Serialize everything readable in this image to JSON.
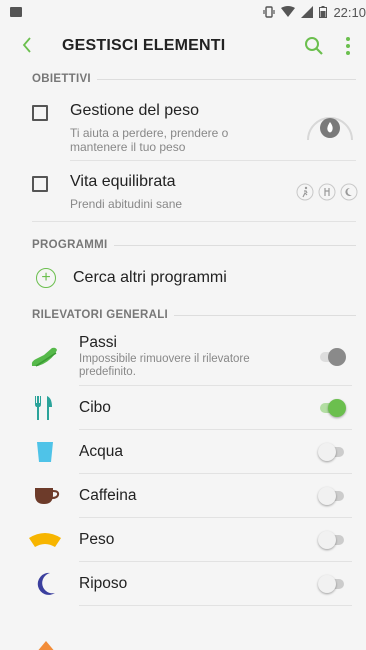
{
  "status_bar": {
    "time": "22:10"
  },
  "app_bar": {
    "back_icon": "chevron-left-icon",
    "title": "GESTISCI ELEMENTI",
    "actions": [
      "search-icon",
      "more-vertical-icon"
    ],
    "accent_color": "#6bbf4e"
  },
  "goals": {
    "header": "OBIETTIVI",
    "items": [
      {
        "title": "Gestione del peso",
        "description": "Ti aiuta a perdere, prendere o mantenere il tuo peso",
        "checked": false,
        "icon": "weight-gauge-icon"
      },
      {
        "title": "Vita equilibrata",
        "description": "Prendi abitudini sane",
        "checked": false,
        "icon": "activity-food-sleep-icons"
      }
    ]
  },
  "programs": {
    "header": "PROGRAMMI",
    "find_more_label": "Cerca altri programmi"
  },
  "trackers": {
    "header": "RILEVATORI GENERALI",
    "items": [
      {
        "label": "Passi",
        "sublabel": "Impossibile rimuovere il rilevatore predefinito.",
        "icon": "shoe-icon",
        "state": "locked-on"
      },
      {
        "label": "Cibo",
        "icon": "fork-knife-icon",
        "state": "on"
      },
      {
        "label": "Acqua",
        "icon": "water-glass-icon",
        "state": "off"
      },
      {
        "label": "Caffeina",
        "icon": "coffee-cup-icon",
        "state": "off"
      },
      {
        "label": "Peso",
        "icon": "scale-icon",
        "state": "off"
      },
      {
        "label": "Riposo",
        "icon": "moon-icon",
        "state": "off"
      }
    ]
  }
}
